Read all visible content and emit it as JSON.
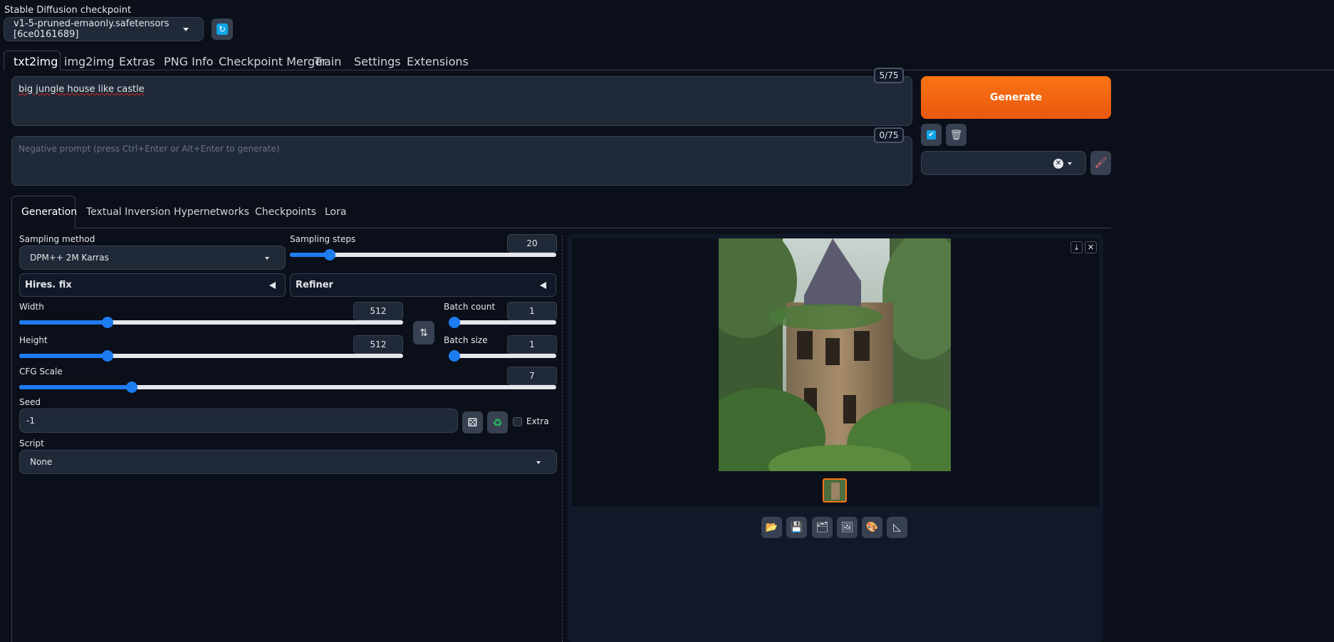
{
  "checkpoint": {
    "label": "Stable Diffusion checkpoint",
    "value": "v1-5-pruned-emaonly.safetensors [6ce0161689]"
  },
  "top_tabs": [
    "txt2img",
    "img2img",
    "Extras",
    "PNG Info",
    "Checkpoint Merger",
    "Train",
    "Settings",
    "Extensions"
  ],
  "prompt": {
    "value": "big jungle house like castle",
    "token_count": "5/75"
  },
  "negative_prompt": {
    "placeholder": "Negative prompt (press Ctrl+Enter or Alt+Enter to generate)",
    "token_count": "0/75"
  },
  "generate_label": "Generate",
  "sub_tabs": [
    "Generation",
    "Textual Inversion",
    "Hypernetworks",
    "Checkpoints",
    "Lora"
  ],
  "sampling_method": {
    "label": "Sampling method",
    "value": "DPM++ 2M Karras"
  },
  "sampling_steps": {
    "label": "Sampling steps",
    "value": "20",
    "fraction": 0.15
  },
  "hires_fix": "Hires. fix",
  "refiner": "Refiner",
  "width": {
    "label": "Width",
    "value": "512",
    "fraction": 0.23
  },
  "height": {
    "label": "Height",
    "value": "512",
    "fraction": 0.23
  },
  "batch_count": {
    "label": "Batch count",
    "value": "1",
    "fraction": 0.0
  },
  "batch_size": {
    "label": "Batch size",
    "value": "1",
    "fraction": 0.0
  },
  "cfg_scale": {
    "label": "CFG Scale",
    "value": "7",
    "fraction": 0.21
  },
  "seed": {
    "label": "Seed",
    "value": "-1",
    "extra_label": "Extra"
  },
  "script": {
    "label": "Script",
    "value": "None"
  },
  "colors": {
    "accent": "#1e7cf1",
    "generate": "#f97316",
    "background": "#0b0f19"
  }
}
